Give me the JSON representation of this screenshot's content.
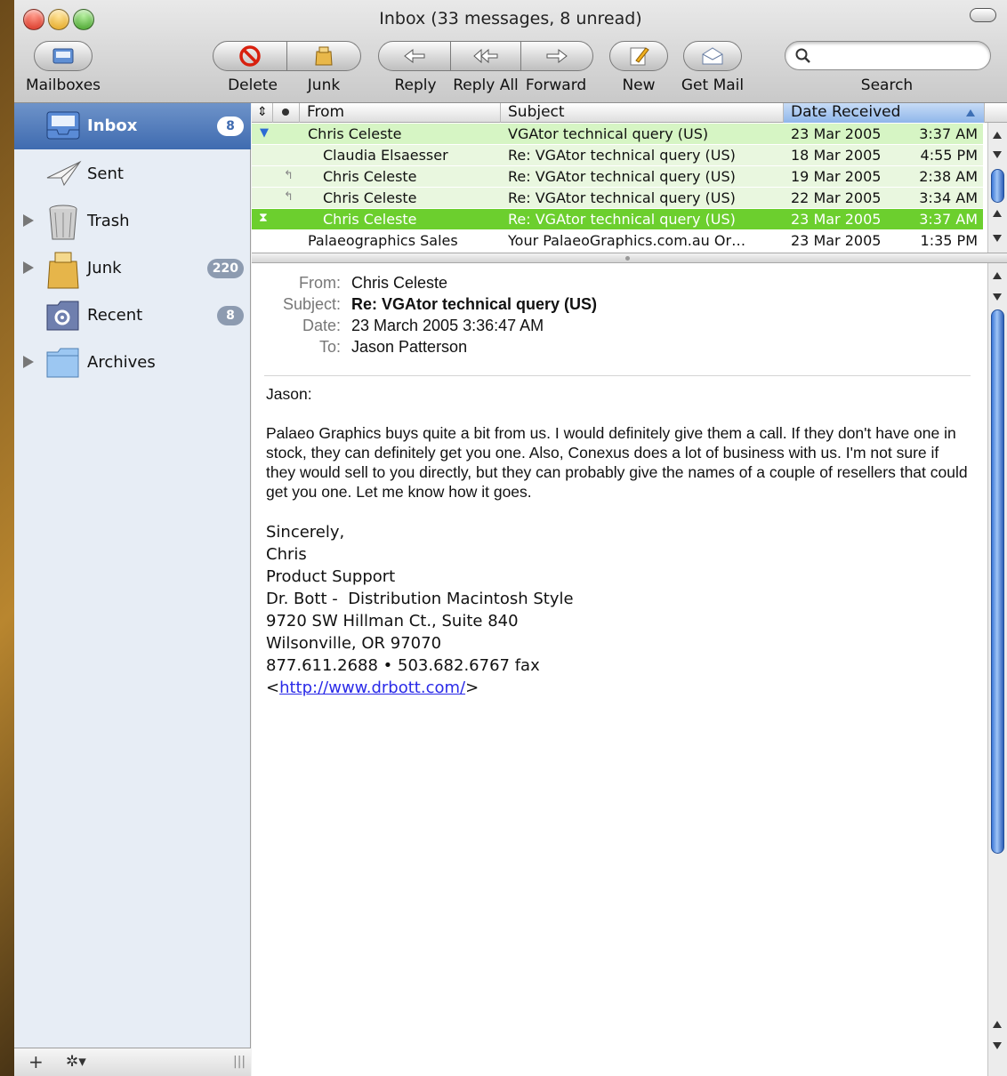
{
  "window": {
    "title": "Inbox (33 messages, 8 unread)"
  },
  "toolbar": {
    "mailboxes_label": "Mailboxes",
    "delete_label": "Delete",
    "junk_label": "Junk",
    "reply_label": "Reply",
    "reply_all_label": "Reply All",
    "forward_label": "Forward",
    "new_label": "New",
    "get_mail_label": "Get Mail",
    "search_label": "Search",
    "search_value": ""
  },
  "sidebar": {
    "items": [
      {
        "label": "Inbox",
        "badge": "8",
        "selected": true,
        "icon": "inbox-tray-icon"
      },
      {
        "label": "Sent",
        "badge": "",
        "icon": "paper-plane-icon"
      },
      {
        "label": "Trash",
        "badge": "",
        "icon": "trash-can-icon"
      },
      {
        "label": "Junk",
        "badge": "220",
        "icon": "junk-bag-icon"
      },
      {
        "label": "Recent",
        "badge": "8",
        "icon": "smart-folder-gear-icon"
      },
      {
        "label": "Archives",
        "badge": "",
        "icon": "folder-icon"
      }
    ],
    "add_label": "+",
    "action_label": "✲▾"
  },
  "list": {
    "columns": {
      "from": "From",
      "subject": "Subject",
      "date": "Date Received"
    },
    "rows": [
      {
        "from": "Chris Celeste",
        "subject": "VGAtor technical query (US)",
        "date": "23 Mar 2005",
        "time": "3:37 AM"
      },
      {
        "from": "Claudia Elsaesser",
        "subject": "Re: VGAtor technical query (US)",
        "date": "18 Mar 2005",
        "time": "4:55 PM"
      },
      {
        "from": "Chris Celeste",
        "subject": "Re: VGAtor technical query (US)",
        "date": "19 Mar 2005",
        "time": "2:38 AM"
      },
      {
        "from": "Chris Celeste",
        "subject": "Re: VGAtor technical query (US)",
        "date": "22 Mar 2005",
        "time": "3:34 AM"
      },
      {
        "from": "Chris Celeste",
        "subject": "Re: VGAtor technical query (US)",
        "date": "23 Mar 2005",
        "time": "3:37 AM"
      },
      {
        "from": "Palaeographics Sales",
        "subject": "Your PalaeoGraphics.com.au Or…",
        "date": "23 Mar 2005",
        "time": "1:35 PM"
      }
    ]
  },
  "message": {
    "from_label": "From:",
    "from": "Chris Celeste",
    "subject_label": "Subject:",
    "subject": "Re: VGAtor technical query (US)",
    "date_label": "Date:",
    "date": "23 March 2005 3:36:47 AM",
    "to_label": "To:",
    "to": "Jason Patterson",
    "greeting": "Jason:",
    "body": "Palaeo Graphics buys quite a bit from us. I would definitely give them a call. If they don't have one in stock, they can definitely get you one. Also, Conexus does a lot of business with us. I'm not sure if they would sell to you directly, but they can probably give the names of a couple of resellers that could get you one. Let me know how it goes.",
    "sig": {
      "closing": "Sincerely,",
      "name": "Chris",
      "dept": "Product Support",
      "company": "Dr. Bott -  Distribution Macintosh Style",
      "address1": "9720 SW Hillman Ct., Suite 840",
      "address2": "Wilsonville, OR 97070",
      "phone": "877.611.2688 • 503.682.6767 fax",
      "link_open": "<",
      "link": "http://www.drbott.com/",
      "link_close": ">"
    }
  }
}
